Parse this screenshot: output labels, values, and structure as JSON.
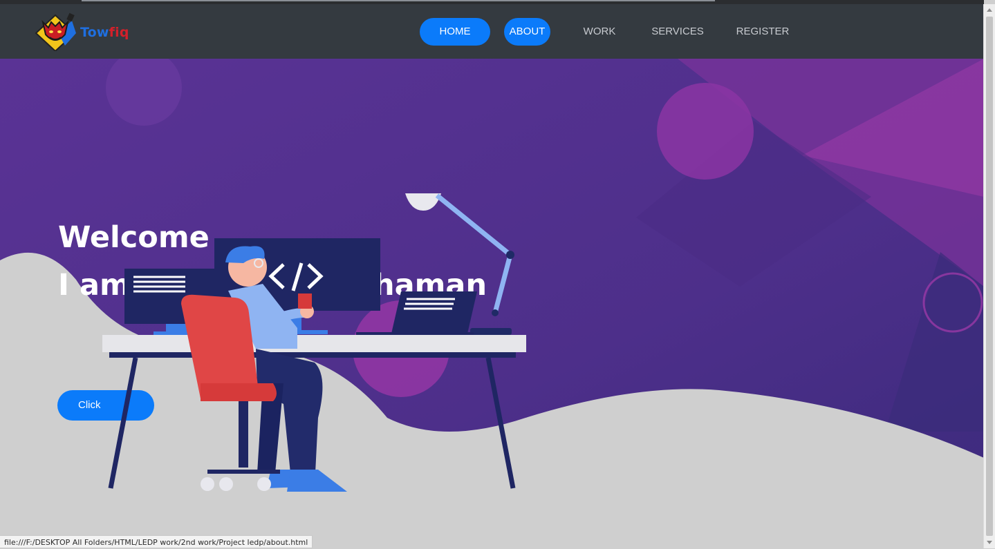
{
  "brand": {
    "name_part1": "Tow",
    "name_part2": "fiq",
    "logo_icon": "devil-mascot-icon"
  },
  "nav": {
    "items": [
      {
        "label": "HOME",
        "active": true
      },
      {
        "label": "ABOUT",
        "active": true
      },
      {
        "label": "WORK",
        "active": false
      },
      {
        "label": "SERVICES",
        "active": false
      },
      {
        "label": "REGISTER",
        "active": false
      }
    ]
  },
  "hero": {
    "line1": "Welcome",
    "line2_start": "I am",
    "line2_end": "haman",
    "cta_label": "Click",
    "illustration_icon": "developer-at-desk-illustration"
  },
  "status_bar": {
    "url": "file:///F:/DESKTOP All Folders/HTML/LEDP work/2nd work/Project ledp/about.html"
  },
  "colors": {
    "navbar_bg": "#343a40",
    "accent": "#0b7bfa",
    "hero_purple": "#55308f",
    "wave_gray": "#cfcfcf"
  }
}
